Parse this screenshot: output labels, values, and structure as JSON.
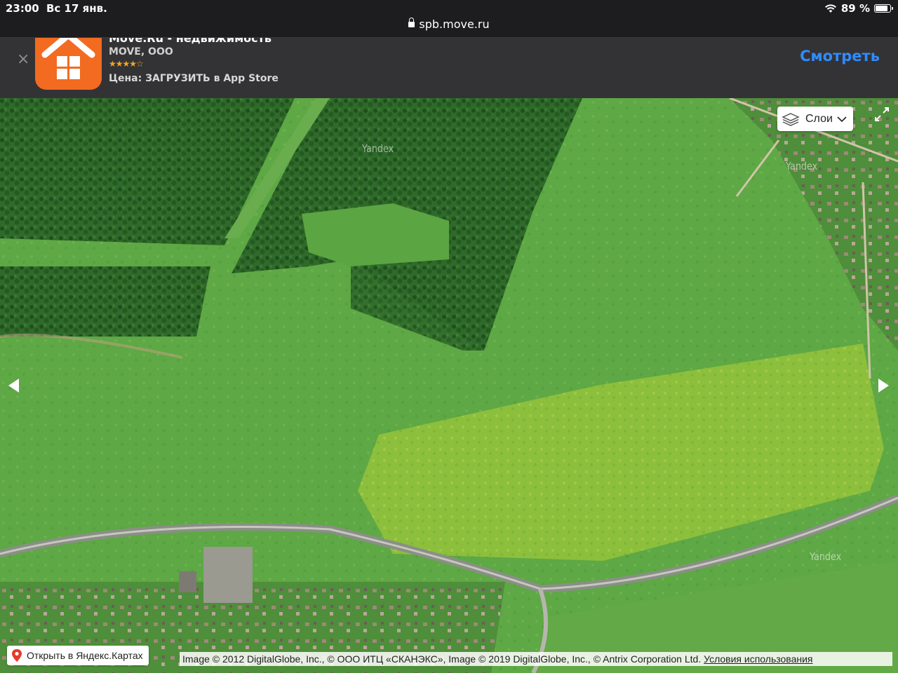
{
  "status_bar": {
    "time": "23:00",
    "date": "Вс 17 янв.",
    "battery_text": "89 %",
    "battery_level": 0.89
  },
  "url_bar": {
    "domain": "spb.move.ru"
  },
  "app_banner": {
    "app_name": "Move.Ru - недвижимость",
    "developer": "MOVE, ООО",
    "rating_stars": "★★★★☆",
    "price_line": "Цена: ЗАГРУЗИТЬ в App Store",
    "view_button": "Смотреть",
    "close_glyph": "×",
    "accent_color": "#2f8cff",
    "icon_color": "#f26b21"
  },
  "map": {
    "layers_button": "Слои",
    "watermark": "Yandex",
    "open_in_yandex": "Открыть в Яндекс.Картах",
    "attribution": "Image © 2012 DigitalGlobe, Inc., © ООО ИТЦ «СКАНЭКС», Image © 2019 DigitalGlobe, Inc., © Antrix Corporation Ltd.",
    "terms_link": "Условия использования",
    "icons": [
      "layers-icon",
      "expand-icon",
      "arrow-left-icon",
      "arrow-right-icon",
      "map-pin-icon"
    ]
  }
}
